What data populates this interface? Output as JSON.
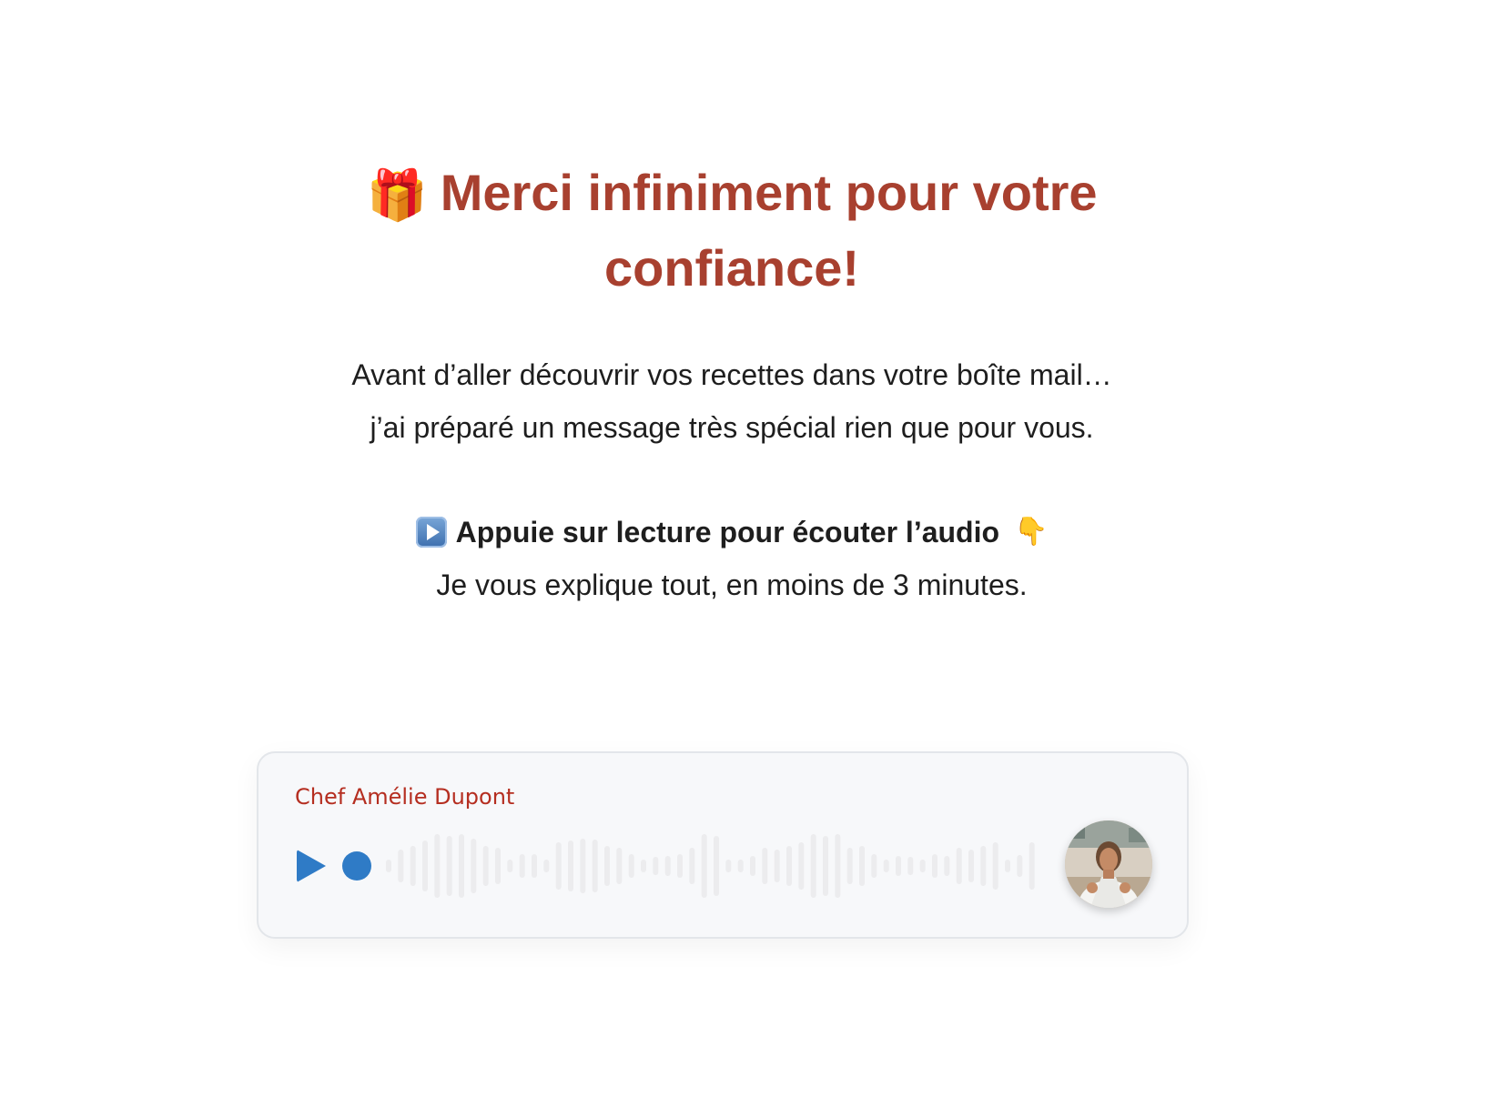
{
  "heading": {
    "emoji": "🎁",
    "text": "Merci infiniment pour votre confiance!"
  },
  "intro": {
    "line1": "Avant d’aller découvrir vos recettes dans votre boîte mail…",
    "line2": "j’ai préparé un message très spécial rien que pour vous."
  },
  "cta": {
    "play_emoji": "play-button-icon",
    "label": "Appuie sur lecture pour écouter l’audio",
    "hand_emoji": "👇",
    "subtext": "Je vous explique tout, en moins de 3 minutes."
  },
  "audio_player": {
    "author": "Chef Amélie Dupont",
    "play_icon": "play-icon",
    "progress": 0,
    "waveform_bar_count": 54,
    "avatar_icon": "chef-avatar-photo",
    "colors": {
      "accent": "#2f7bc6",
      "author": "#b52e20",
      "waveform": "#ececee"
    }
  },
  "colors": {
    "heading": "#a8402f",
    "body_text": "#1e1e1e",
    "background": "#ffffff"
  }
}
